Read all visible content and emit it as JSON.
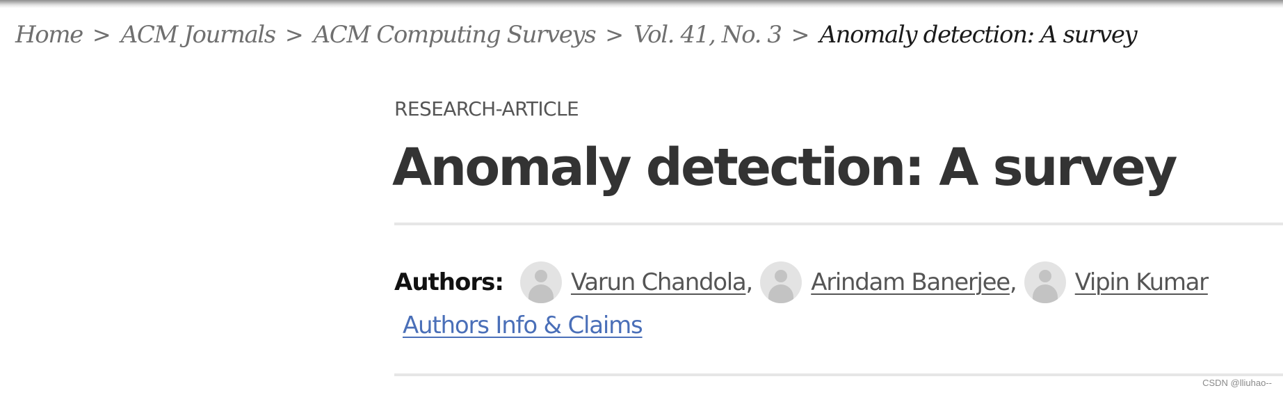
{
  "breadcrumb": {
    "items": [
      {
        "label": "Home"
      },
      {
        "label": "ACM Journals"
      },
      {
        "label": "ACM Computing Surveys"
      },
      {
        "label": "Vol. 41, No. 3"
      },
      {
        "label": "Anomaly detection: A survey"
      }
    ],
    "separator": ">"
  },
  "article": {
    "type": "RESEARCH-ARTICLE",
    "title": "Anomaly detection: A survey"
  },
  "authors": {
    "label": "Authors:",
    "list": [
      {
        "name": "Varun Chandola",
        "icon": "person-avatar-icon"
      },
      {
        "name": "Arindam Banerjee",
        "icon": "person-avatar-icon"
      },
      {
        "name": "Vipin Kumar",
        "icon": "person-avatar-icon"
      }
    ],
    "separator": ",",
    "info_link": "Authors Info & Claims"
  },
  "watermark": "CSDN @lliuhao--",
  "colors": {
    "link_blue": "#4a6fb8",
    "title_text": "#333333",
    "muted_text": "#6f6f6f",
    "divider": "#e6e6e6",
    "avatar_bg": "#e3e3e3"
  }
}
